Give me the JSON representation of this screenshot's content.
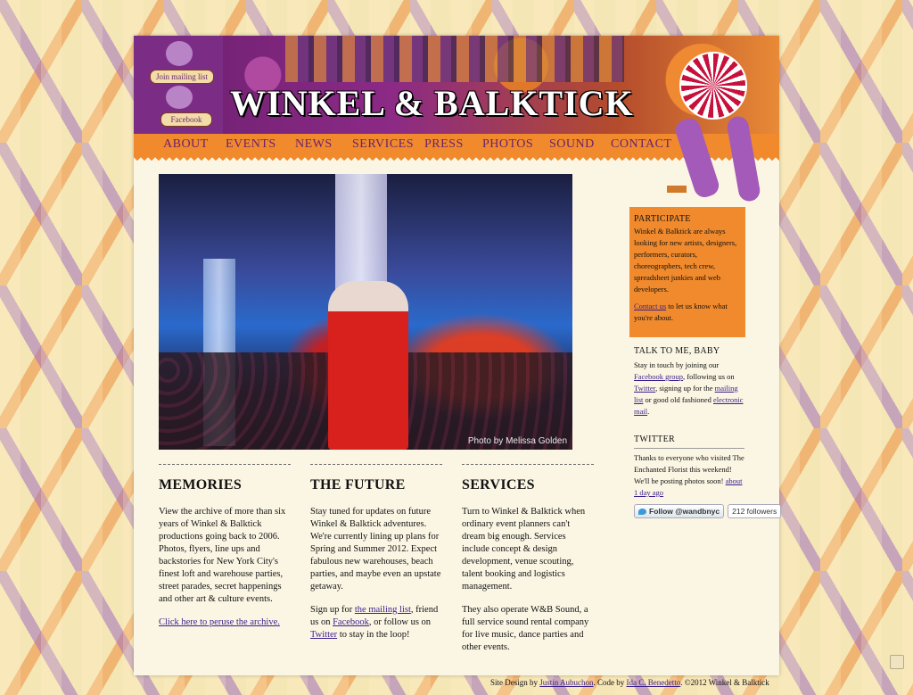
{
  "header": {
    "logo_text": "WINKEL & BALKTICK",
    "join_mailing_list": "Join mailing list",
    "facebook": "Facebook"
  },
  "nav": {
    "items": [
      "ABOUT",
      "EVENTS",
      "NEWS",
      "SERVICES",
      "PRESS",
      "PHOTOS",
      "SOUND",
      "CONTACT"
    ]
  },
  "photo": {
    "credit": "Photo by Melissa Golden"
  },
  "columns": {
    "memories": {
      "heading": "MEMORIES",
      "body": "View the archive of more than six years of Winkel & Balktick productions going back to 2006. Photos, flyers, line ups and backstories for New York City's finest loft and warehouse parties, street parades, secret happenings and other art & culture events.",
      "link": "Click here to peruse the archive."
    },
    "future": {
      "heading": "THE FUTURE",
      "body": "Stay tuned for updates on future Winkel & Balktick adventures. We're currently lining up plans for Spring and Summer 2012. Expect fabulous new warehouses, beach parties, and maybe even an upstate getaway.",
      "signup_pre": "Sign up for ",
      "mailing_link": "the mailing list",
      "friend_pre": ", friend us on ",
      "facebook_link": "Facebook",
      "follow_pre": ", or follow us on ",
      "twitter_link": "Twitter",
      "follow_post": " to stay in the loop!"
    },
    "services": {
      "heading": "SERVICES",
      "body1": "Turn to Winkel & Balktick when ordinary event planners can't dream big enough. Services include concept & design development, venue scouting, talent booking and logistics management.",
      "body2": "They also operate W&B Sound, a full service sound rental company for live music, dance parties and other events."
    }
  },
  "sidebar": {
    "participate": {
      "heading": "PARTICIPATE",
      "body": "Winkel & Balktick are always looking for new artists, designers, performers, curators, choreographers, tech crew, spreadsheet junkies and web developers.",
      "contact_link": "Contact us",
      "contact_post": " to let us know what you're about."
    },
    "talk": {
      "heading": "TALK TO ME, BABY",
      "pre": "Stay in touch by joining our ",
      "facebook_group": "Facebook group",
      "mid1": ", following us on ",
      "twitter": "Twitter",
      "mid2": ", signing up for the ",
      "mailing_list": "mailing list",
      "mid3": " or good old fashioned ",
      "email": "electronic mail",
      "post": "."
    },
    "twitter": {
      "heading": "TWITTER",
      "tweet": "Thanks to everyone who visited The Enchanted Florist this weekend! We'll be posting photos soon!",
      "time": "about 1 day ago",
      "follow_button": "Follow @wandbnyc",
      "followers": "212 followers"
    }
  },
  "footer": {
    "site_design_pre": "Site Design by ",
    "designer": "Justin Aubuchon",
    "code_pre": ". Code by ",
    "coder": "Ida C. Benedetto",
    "post": ". ©2012 Winkel & Balktick"
  }
}
